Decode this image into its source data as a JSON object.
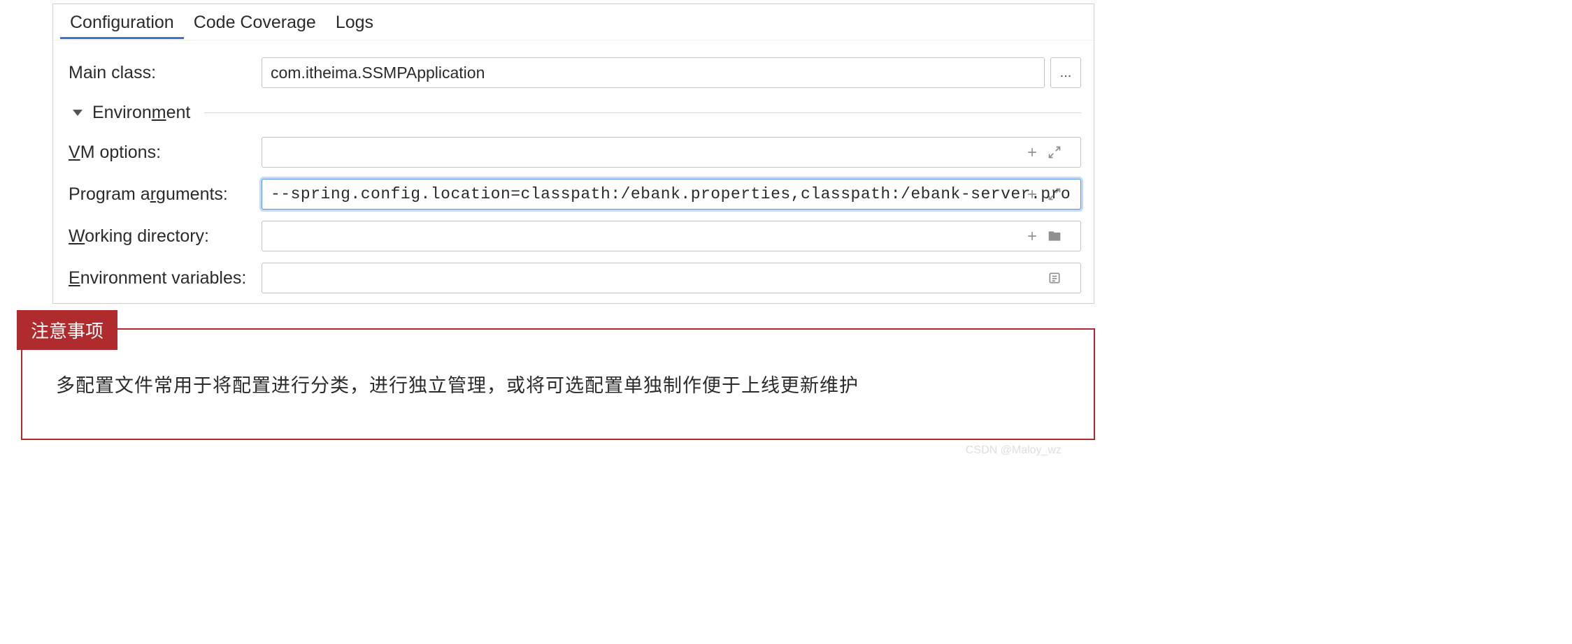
{
  "tabs": {
    "configuration": "Configuration",
    "code_coverage": "Code Coverage",
    "logs": "Logs"
  },
  "form": {
    "main_class_label": "Main class:",
    "main_class_value": "com.itheima.SSMPApplication",
    "environment_label_parts": {
      "pre": "Environ",
      "u": "m",
      "post": "ent"
    },
    "vm_options_label_parts": {
      "u": "V",
      "post": "M options:"
    },
    "vm_options_value": "",
    "program_args_label_parts": {
      "pre": "Program a",
      "u": "r",
      "post": "guments:"
    },
    "program_args_value": "--spring.config.location=classpath:/ebank.properties,classpath:/ebank-server.properties",
    "working_dir_label_parts": {
      "u": "W",
      "post": "orking directory:"
    },
    "working_dir_value": "",
    "env_vars_label_parts": {
      "u": "E",
      "post": "nvironment variables:"
    },
    "env_vars_value": "",
    "browse_label": "..."
  },
  "note": {
    "badge": "注意事项",
    "text": "多配置文件常用于将配置进行分类，进行独立管理，或将可选配置单独制作便于上线更新维护"
  },
  "watermark": "CSDN @Maloy_wz"
}
